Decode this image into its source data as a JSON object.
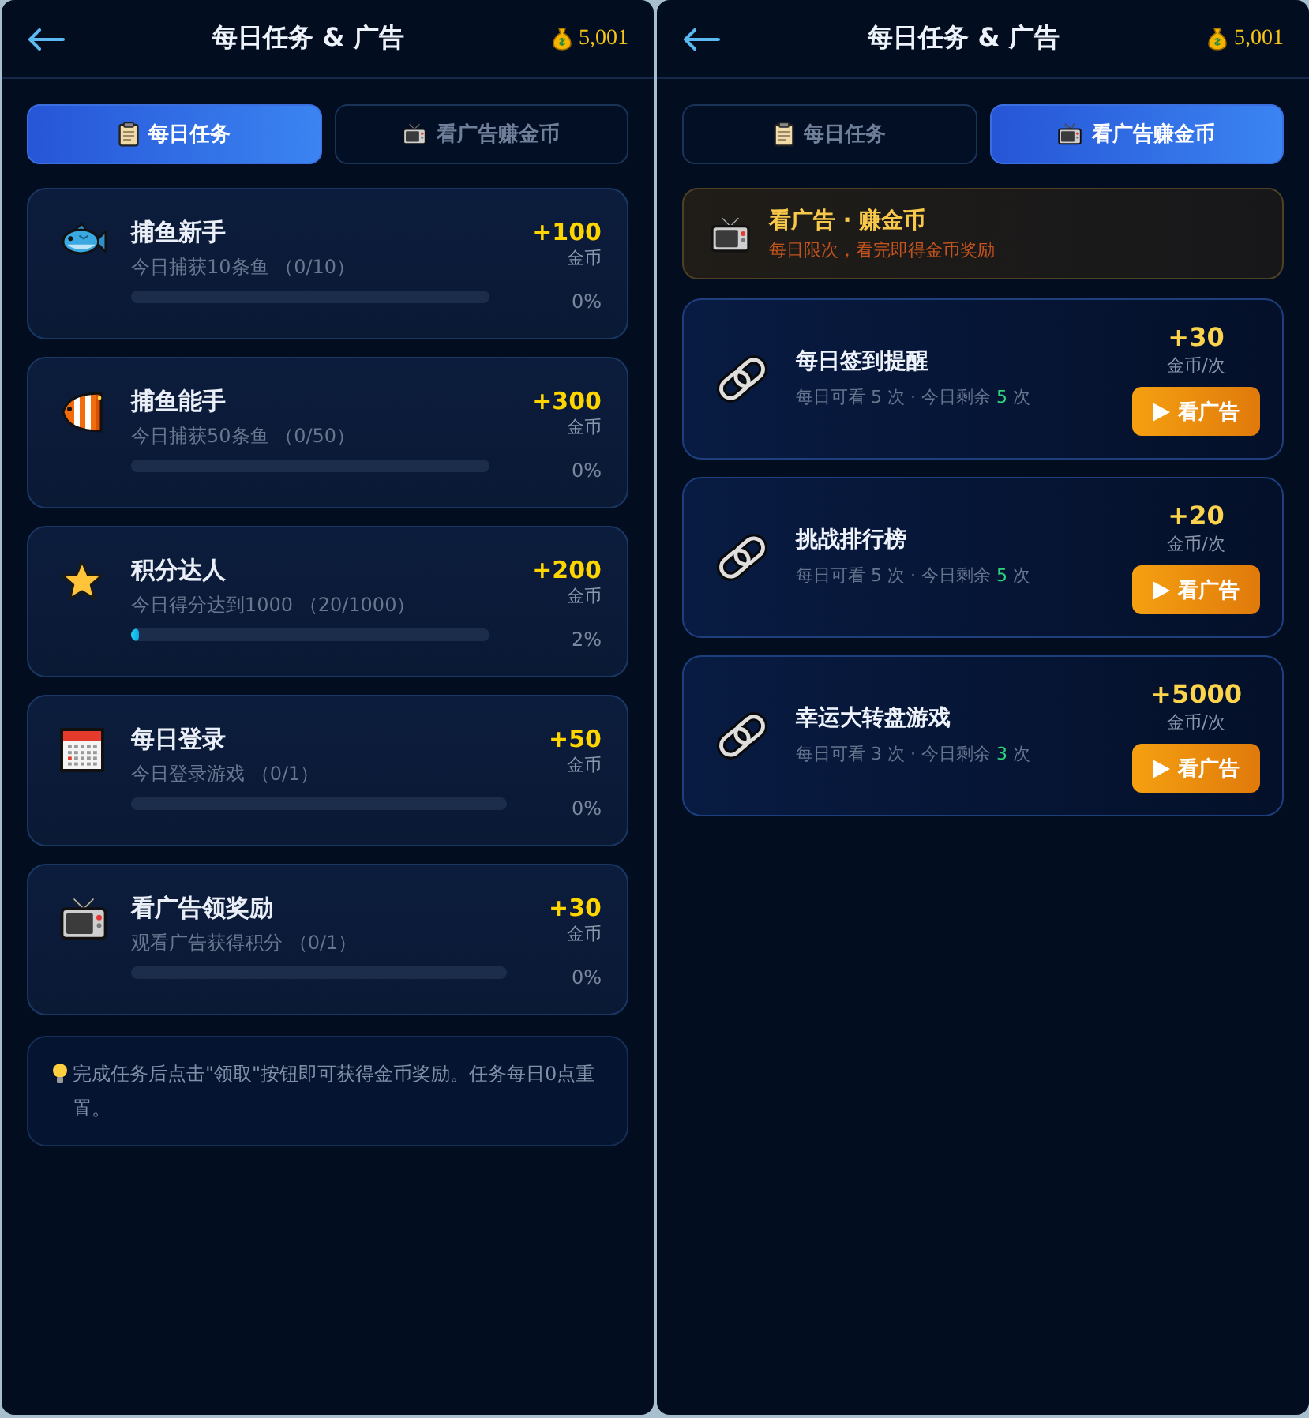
{
  "screens": [
    {
      "kind": "tasks",
      "header": {
        "title": "每日任务 & 广告",
        "coins": "5,001"
      },
      "tabs": [
        {
          "label": "每日任务",
          "selected": true
        },
        {
          "label": "看广告赚金币",
          "selected": false
        }
      ],
      "tasks": [
        {
          "title": "捕鱼新手",
          "description": "今日捕获10条鱼 （0/10）",
          "reward": "+100",
          "unit": "金币",
          "level": 0,
          "percent": "0%"
        },
        {
          "title": "捕鱼能手",
          "description": "今日捕获50条鱼 （0/50）",
          "reward": "+300",
          "unit": "金币",
          "level": 0,
          "percent": "0%"
        },
        {
          "title": "积分达人",
          "description": "今日得分达到1000 （20/1000）",
          "reward": "+200",
          "unit": "金币",
          "level": 0.02,
          "percent": "2%"
        },
        {
          "title": "每日登录",
          "description": "今日登录游戏 （0/1）",
          "reward": "+50",
          "unit": "金币",
          "level": 0,
          "percent": "0%"
        },
        {
          "title": "看广告领奖励",
          "description": "观看广告获得积分 （0/1）",
          "reward": "+30",
          "unit": "金币",
          "level": 0,
          "percent": "0%"
        }
      ],
      "tip": "完成任务后点击\"领取\"按钮即可获得金币奖励。任务每日0点重置。"
    },
    {
      "kind": "ads",
      "header": {
        "title": "每日任务 & 广告",
        "coins": "5,001"
      },
      "tabs": [
        {
          "label": "每日任务",
          "selected": false
        },
        {
          "label": "看广告赚金币",
          "selected": true
        }
      ],
      "banner": {
        "title": "看广告 · 赚金币",
        "subtitle": "每日限次，看完即得金币奖励"
      },
      "ads": [
        {
          "title": "每日签到提醒",
          "quota": "每日可看 5 次 · 今日剩余",
          "remaining": "5",
          "remaining_unit": "次",
          "reward": "+30",
          "reward_unit": "金币/次",
          "button": "看广告"
        },
        {
          "title": "挑战排行榜",
          "quota": "每日可看 5 次 · 今日剩余",
          "remaining": "5",
          "remaining_unit": "次",
          "reward": "+20",
          "reward_unit": "金币/次",
          "button": "看广告"
        },
        {
          "title": "幸运大转盘游戏",
          "quota": "每日可看 3 次 · 今日剩余",
          "remaining": "3",
          "remaining_unit": "次",
          "reward": "+5000",
          "reward_unit": "金币/次",
          "button": "看广告"
        }
      ]
    }
  ]
}
